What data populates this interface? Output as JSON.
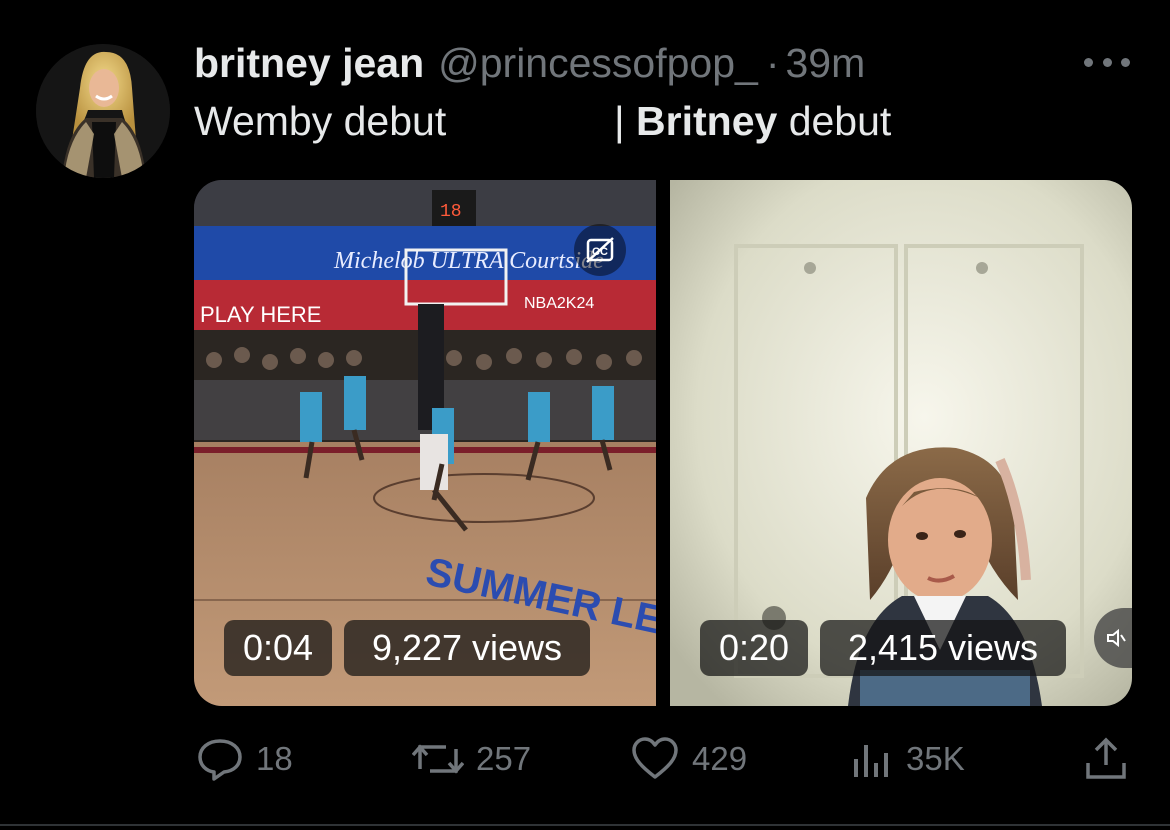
{
  "tweet": {
    "display_name": "britney jean",
    "handle": "@princessofpop_",
    "separator": "·",
    "time": "39m",
    "text_left": "Wemby debut",
    "text_right_prefix": "| ",
    "text_right_bold": "Britney",
    "text_right_suffix": " debut"
  },
  "media": {
    "video1": {
      "duration": "0:04",
      "views": "9,227 views",
      "scene": "basketball game"
    },
    "video2": {
      "duration": "0:20",
      "views": "2,415 views",
      "scene": "music video"
    }
  },
  "actions": {
    "replies": "18",
    "reposts": "257",
    "likes": "429",
    "views": "35K"
  },
  "icons": [
    "more-icon",
    "closed-captions-icon",
    "volume-icon",
    "reply-icon",
    "repost-icon",
    "like-icon",
    "views-icon",
    "share-icon"
  ],
  "colors": {
    "background": "#000000",
    "primary_text": "#e7e9ea",
    "secondary_text": "#71767b"
  }
}
